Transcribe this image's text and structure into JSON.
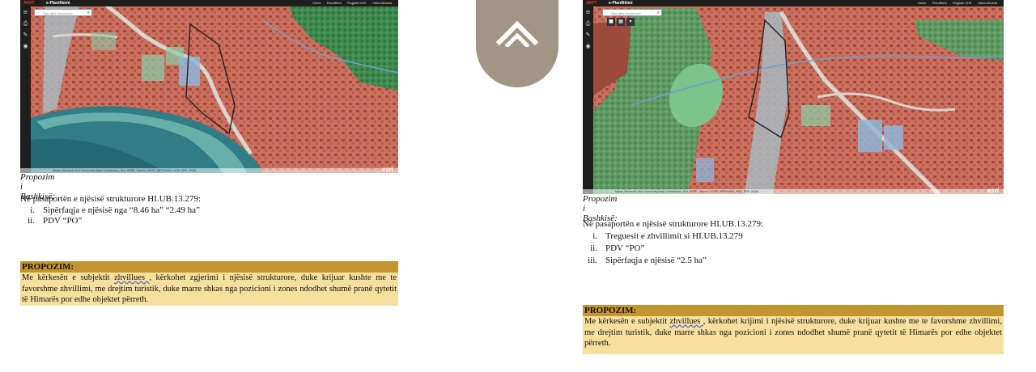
{
  "map_ui": {
    "brand": "AKPT",
    "app_title": "e-Planifikimi",
    "search_placeholder": "Gjej njësi strukturore",
    "top_links": [
      "Home",
      "Planifikimi",
      "Regjistri DHE",
      "Harta Albania"
    ],
    "esri_logo": "esri",
    "attribution": "Maxar, Microsoft, Esri Community Maps Contributors, Esri, HERE, Garmin, USGS, METI/NASA, NGA, EPA, USDA",
    "colors": {
      "development_zone": "#c9705f",
      "green_zone": "#3f8a4f",
      "sea": "#2f7d86",
      "road": "#d9d5cf",
      "blue_parcel": "#8fb6d9"
    }
  },
  "logo_icon": "double-chevron-up-icon",
  "left": {
    "caption": "Propozim i Bashkisë:",
    "intro": "Në pasaportën e njësisë strukturore HI.UB.13.279:",
    "items": [
      {
        "num": "i.",
        "text": "Sipërfaqja e njësisë nga “8.46 ha” “2.49 ha”"
      },
      {
        "num": "ii.",
        "text": "PDV “PO”"
      }
    ],
    "proposal_title": "PROPOZIM:",
    "proposal_before": "Me kërkesën e subjektit ",
    "proposal_underlined": "zhvillues ",
    "proposal_after": ", kërkohet zgjerimi i njësisë strukturore, duke krijuar kushte me te favorshme zhvillimi, me drejtim turistik, duke marre shkas nga pozicioni i zones ndodhet shumë pranë qytetit të Himarës por edhe objektet përreth."
  },
  "right": {
    "caption": "Propozim i Bashkisë:",
    "intro": "Në pasaportën e njësisë strukturore HI.UB.13.279:",
    "items": [
      {
        "num": "i.",
        "text": "Treguesit e zhvillimit si HI.UB.13.279"
      },
      {
        "num": "ii.",
        "text": "PDV “PO”"
      },
      {
        "num": "iii.",
        "text": "Sipërfaqja e njësisë “2.5 ha”"
      }
    ],
    "proposal_title": "PROPOZIM:",
    "proposal_before": "Me kërkesën e subjektit ",
    "proposal_underlined": "zhvillues ",
    "proposal_after": ", kërkohet krijimi i njësisë strukturore, duke krijuar kushte me te favorshme zhvillimi, me drejtim turistik, duke marre shkas nga pozicioni i zones ndodhet shumë pranë qytetit të Himarës por edhe objektet përreth."
  }
}
